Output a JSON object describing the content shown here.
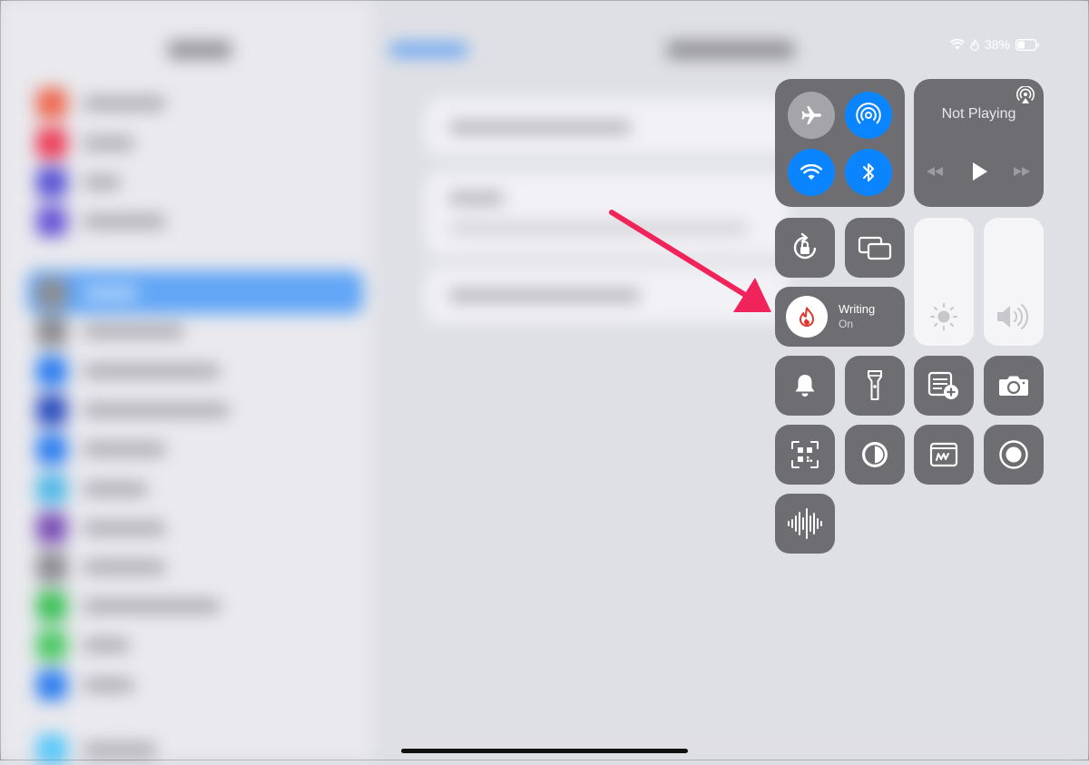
{
  "status_bar": {
    "battery": "38%",
    "wifi_icon": "wifi-icon",
    "focus_icon": "focus-flame-icon",
    "battery_icon": "battery-icon"
  },
  "media": {
    "label": "Not Playing",
    "icons": [
      "airplay-icon",
      "rewind-icon",
      "play-icon",
      "fast-forward-icon"
    ]
  },
  "connectivity": {
    "icons": [
      "airplane-mode-icon",
      "airdrop-icon",
      "wifi-icon",
      "bluetooth-icon"
    ],
    "active_color": "#0a84ff"
  },
  "focus": {
    "title": "Writing",
    "state": "On",
    "icon": "flame-icon",
    "icon_color": "#e0352b"
  },
  "sliders": {
    "brightness_icon": "sun-icon",
    "volume_icon": "speaker-icon"
  },
  "controls": [
    "rotation-lock-icon",
    "screen-mirroring-icon",
    "bell-icon",
    "flashlight-icon",
    "quick-note-icon",
    "camera-icon",
    "qr-code-scanner-icon",
    "dark-mode-icon",
    "markup-icon",
    "screen-recording-icon",
    "voice-memos-icon"
  ],
  "annotation": {
    "arrow_color": "#f0245a"
  }
}
